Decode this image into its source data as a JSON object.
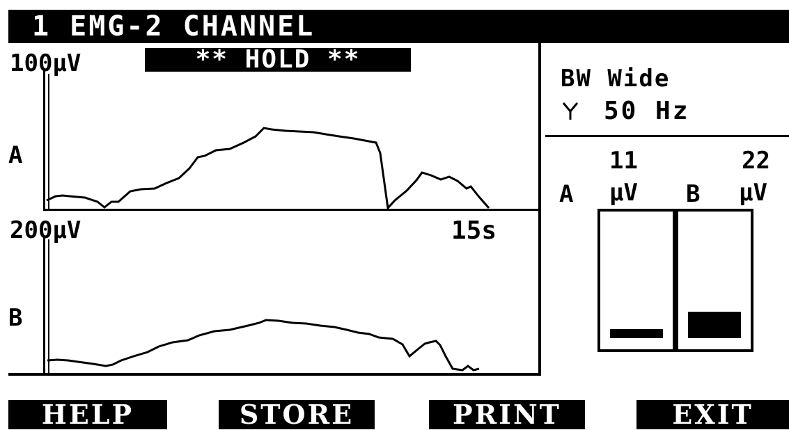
{
  "title": "1 EMG-2 CHANNEL",
  "colors": {
    "screen_bg": "#ffffff",
    "ink": "#000000"
  },
  "plot_a": {
    "scale": "100μV",
    "hold_badge": "** HOLD **",
    "label": "A"
  },
  "plot_b": {
    "scale": "200μV",
    "time": "15s",
    "label": "B"
  },
  "bandwidth": {
    "line1": "BW Wide",
    "filter_icon": "notch-filter-icon",
    "line2": "50 Hz"
  },
  "levels": {
    "a_label": "A",
    "a_value": "11",
    "a_unit": "μV",
    "b_label": "B",
    "b_value": "22",
    "b_unit": "μV",
    "a_fill": 0.07,
    "b_fill": 0.2
  },
  "softkeys": [
    "HELP",
    "STORE",
    "PRINT",
    "EXIT"
  ]
}
